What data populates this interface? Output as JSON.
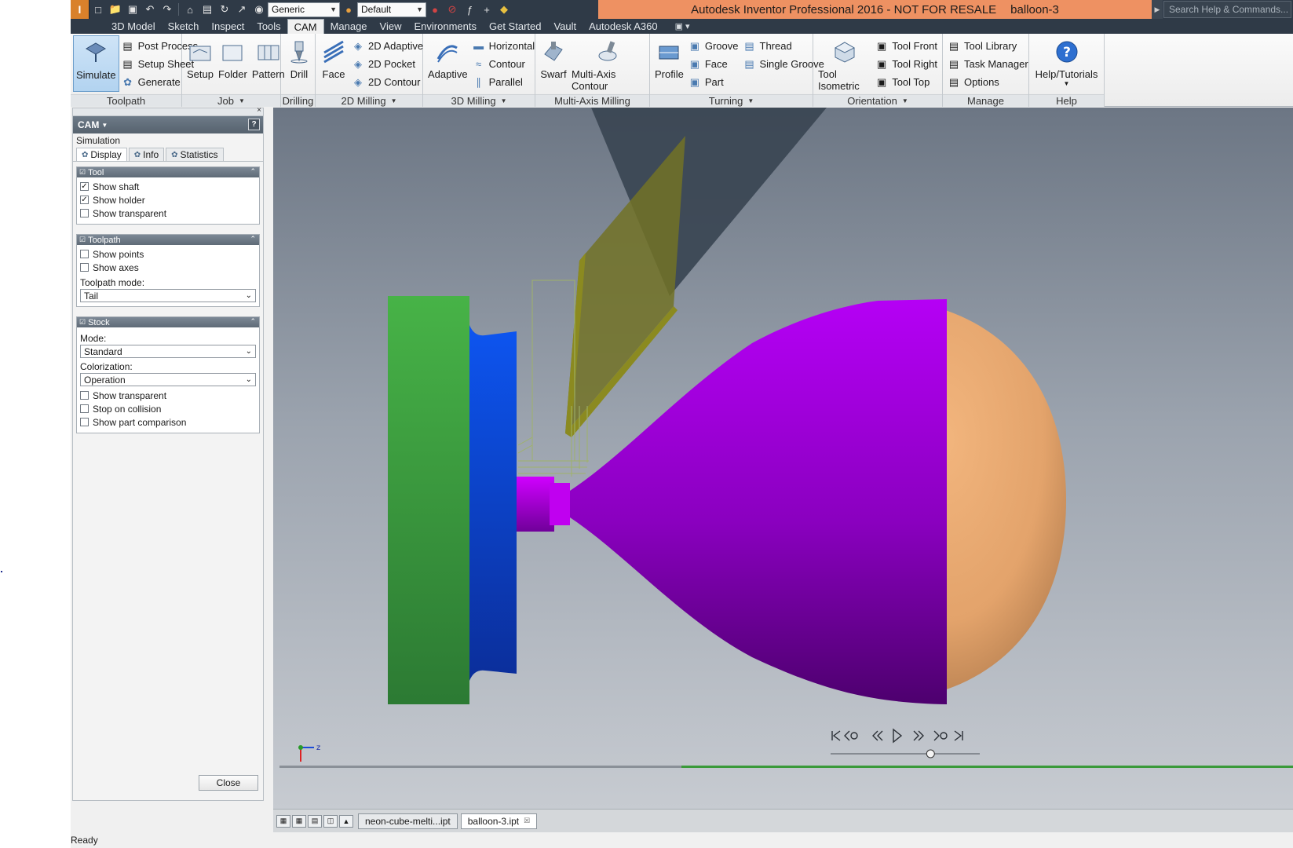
{
  "window": {
    "title": "Autodesk Inventor Professional 2016 - NOT FOR RESALE",
    "document": "balloon-3",
    "search_placeholder": "Search Help & Commands..."
  },
  "quick_access": {
    "material_select": "Generic",
    "appearance_select": "Default",
    "icons": [
      "new-icon",
      "open-icon",
      "save-icon",
      "undo-icon",
      "redo-icon",
      "home-icon",
      "measure-icon",
      "update-icon",
      "select-icon",
      "appearance-icon",
      "color-icon",
      "material-icon",
      "function-icon",
      "plus-icon",
      "customize-icon"
    ]
  },
  "tabs": [
    {
      "label": "3D Model",
      "active": false
    },
    {
      "label": "Sketch",
      "active": false
    },
    {
      "label": "Inspect",
      "active": false
    },
    {
      "label": "Tools",
      "active": false
    },
    {
      "label": "CAM",
      "active": true
    },
    {
      "label": "Manage",
      "active": false
    },
    {
      "label": "View",
      "active": false
    },
    {
      "label": "Environments",
      "active": false
    },
    {
      "label": "Get Started",
      "active": false
    },
    {
      "label": "Vault",
      "active": false
    },
    {
      "label": "Autodesk A360",
      "active": false
    }
  ],
  "ribbon": {
    "toolpath": {
      "label": "Toolpath",
      "simulate": "Simulate",
      "post_process": "Post Process",
      "setup_sheet": "Setup Sheet",
      "generate": "Generate"
    },
    "job": {
      "label": "Job",
      "setup": "Setup",
      "folder": "Folder",
      "pattern": "Pattern"
    },
    "drilling": {
      "label": "Drilling",
      "drill": "Drill"
    },
    "milling2d": {
      "label": "2D Milling",
      "face": "Face",
      "adaptive2d": "2D Adaptive",
      "pocket2d": "2D Pocket",
      "contour2d": "2D Contour"
    },
    "milling3d": {
      "label": "3D Milling",
      "adaptive": "Adaptive",
      "horizontal": "Horizontal",
      "contour": "Contour",
      "parallel": "Parallel"
    },
    "multiaxis": {
      "label": "Multi-Axis Milling",
      "swarf": "Swarf",
      "multi_axis_contour": "Multi-Axis Contour"
    },
    "turning": {
      "label": "Turning",
      "profile": "Profile",
      "groove": "Groove",
      "face": "Face",
      "part": "Part",
      "thread": "Thread",
      "single_groove": "Single Groove"
    },
    "orientation": {
      "label": "Orientation",
      "tool_isometric": "Tool Isometric",
      "tool_front": "Tool Front",
      "tool_right": "Tool Right",
      "tool_top": "Tool Top"
    },
    "manage": {
      "label": "Manage",
      "tool_library": "Tool Library",
      "task_manager": "Task Manager",
      "options": "Options"
    },
    "help": {
      "label": "Help",
      "help_tutorials": "Help/Tutorials"
    }
  },
  "panel": {
    "title": "CAM",
    "subtitle": "Simulation",
    "subtabs": [
      "Display",
      "Info",
      "Statistics"
    ],
    "tool_section": {
      "title": "Tool",
      "show_shaft": {
        "label": "Show shaft",
        "checked": true
      },
      "show_holder": {
        "label": "Show holder",
        "checked": true
      },
      "show_transparent": {
        "label": "Show transparent",
        "checked": false
      }
    },
    "toolpath_section": {
      "title": "Toolpath",
      "show_points": {
        "label": "Show points",
        "checked": false
      },
      "show_axes": {
        "label": "Show axes",
        "checked": false
      },
      "mode_label": "Toolpath mode:",
      "mode_value": "Tail"
    },
    "stock_section": {
      "title": "Stock",
      "mode_label": "Mode:",
      "mode_value": "Standard",
      "colorization_label": "Colorization:",
      "colorization_value": "Operation",
      "show_transparent": {
        "label": "Show transparent",
        "checked": false
      },
      "stop_on_collision": {
        "label": "Stop on collision",
        "checked": false
      },
      "show_part_comparison": {
        "label": "Show part comparison",
        "checked": false
      }
    },
    "close_label": "Close"
  },
  "viewport": {
    "axis_label": "z",
    "playback_progress": 0.67,
    "colors": {
      "chuck": "#47b047",
      "stock_blue": "#0b3fd0",
      "balloon_purple": "#a300e0",
      "balloon_tan": "#e8a770",
      "tool_insert": "#7a7a22",
      "tool_holder": "#3c4650"
    }
  },
  "document_tabs": [
    {
      "label": "neon-cube-melti...ipt",
      "active": false
    },
    {
      "label": "balloon-3.ipt",
      "active": true
    }
  ],
  "status": "Ready"
}
